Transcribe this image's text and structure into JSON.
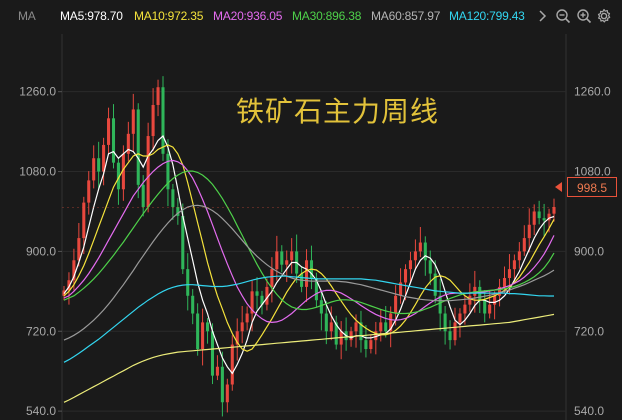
{
  "header": {
    "ma_label": "MA",
    "ma_items": [
      {
        "label": "MA5:978.70",
        "color": "#ffffff"
      },
      {
        "label": "MA10:972.35",
        "color": "#f5e33c"
      },
      {
        "label": "MA20:936.05",
        "color": "#e46cf0"
      },
      {
        "label": "MA30:896.38",
        "color": "#4ed14a"
      },
      {
        "label": "MA60:857.97",
        "color": "#b4b4b4"
      },
      {
        "label": "MA120:799.43",
        "color": "#33d6f0"
      }
    ],
    "icons": [
      "chevron-right-icon",
      "zoom-out-icon",
      "zoom-in-icon",
      "gear-icon"
    ]
  },
  "watermark": "铁矿石主力周线",
  "last_price": "998.5",
  "chart_data": {
    "type": "candlestick",
    "ylim": [
      520,
      1390
    ],
    "y_ticks": [
      "1260.0",
      "1080.0",
      "900.0",
      "720.0",
      "540.0"
    ],
    "y_tick_values": [
      1260,
      1080,
      900,
      720,
      540
    ],
    "colors": {
      "up": "#e8483e",
      "down": "#2fb65a",
      "grid": "#2a2a2a",
      "last": "#e9523a"
    },
    "last_price_value": 998.5,
    "closes": [
      812,
      835,
      880,
      930,
      1010,
      1060,
      1110,
      1080,
      1140,
      1200,
      1100,
      1040,
      1120,
      1165,
      1220,
      1050,
      1000,
      1160,
      1230,
      1270,
      1120,
      1040,
      1000,
      980,
      860,
      800,
      760,
      680,
      740,
      720,
      620,
      640,
      560,
      600,
      690,
      720,
      740,
      760,
      810,
      800,
      780,
      820,
      860,
      900,
      870,
      880,
      900,
      850,
      820,
      880,
      840,
      790,
      760,
      720,
      740,
      690,
      720,
      700,
      720,
      740,
      700,
      680,
      700,
      720,
      740,
      720,
      760,
      800,
      830,
      860,
      880,
      900,
      920,
      880,
      850,
      800,
      760,
      720,
      700,
      740,
      760,
      780,
      800,
      820,
      790,
      760,
      780,
      800,
      820,
      840,
      860,
      880,
      900,
      930,
      960,
      990,
      975,
      970,
      985,
      1000
    ],
    "series": [
      {
        "name": "MA5",
        "values": [
          805,
          820,
          843,
          875,
          910,
          955,
          1000,
          1040,
          1075,
          1120,
          1125,
          1110,
          1120,
          1130,
          1125,
          1110,
          1090,
          1115,
          1130,
          1150,
          1160,
          1135,
          1095,
          1040,
          980,
          930,
          880,
          830,
          790,
          760,
          720,
          690,
          660,
          640,
          625,
          645,
          670,
          700,
          740,
          765,
          780,
          795,
          810,
          830,
          845,
          860,
          875,
          875,
          865,
          860,
          850,
          835,
          810,
          780,
          755,
          735,
          720,
          710,
          705,
          710,
          710,
          705,
          705,
          708,
          712,
          715,
          725,
          745,
          770,
          800,
          830,
          860,
          880,
          890,
          885,
          870,
          845,
          810,
          775,
          745,
          735,
          745,
          760,
          778,
          790,
          790,
          785,
          785,
          790,
          800,
          815,
          835,
          855,
          880,
          905,
          930,
          950,
          965,
          975,
          978.7
        ]
      },
      {
        "name": "MA10",
        "values": [
          800,
          810,
          825,
          845,
          868,
          895,
          925,
          955,
          985,
          1015,
          1045,
          1065,
          1085,
          1100,
          1115,
          1120,
          1115,
          1115,
          1120,
          1130,
          1135,
          1140,
          1135,
          1120,
          1095,
          1055,
          1010,
          965,
          920,
          875,
          835,
          800,
          770,
          740,
          715,
          695,
          680,
          675,
          680,
          695,
          712,
          730,
          748,
          768,
          788,
          808,
          825,
          840,
          850,
          857,
          860,
          858,
          850,
          838,
          822,
          805,
          788,
          772,
          757,
          745,
          735,
          727,
          720,
          715,
          712,
          712,
          715,
          722,
          732,
          745,
          762,
          780,
          800,
          818,
          832,
          842,
          845,
          842,
          835,
          823,
          810,
          800,
          793,
          790,
          790,
          792,
          796,
          800,
          806,
          812,
          820,
          830,
          842,
          858,
          875,
          895,
          915,
          933,
          952,
          972.35
        ]
      },
      {
        "name": "MA20",
        "values": [
          795,
          800,
          810,
          822,
          835,
          850,
          867,
          885,
          905,
          925,
          945,
          965,
          985,
          1005,
          1025,
          1040,
          1055,
          1068,
          1080,
          1090,
          1098,
          1103,
          1105,
          1102,
          1095,
          1082,
          1065,
          1043,
          1017,
          990,
          960,
          930,
          900,
          872,
          845,
          820,
          800,
          782,
          768,
          757,
          748,
          742,
          740,
          741,
          745,
          752,
          760,
          770,
          780,
          790,
          798,
          805,
          810,
          812,
          812,
          810,
          806,
          800,
          793,
          786,
          778,
          771,
          764,
          758,
          753,
          749,
          746,
          745,
          746,
          749,
          754,
          760,
          768,
          776,
          784,
          791,
          797,
          802,
          805,
          806,
          806,
          806,
          806,
          807,
          808,
          809,
          811,
          813,
          816,
          819,
          823,
          828,
          834,
          842,
          852,
          864,
          878,
          894,
          914,
          936.05
        ]
      },
      {
        "name": "MA30",
        "values": [
          790,
          795,
          800,
          808,
          817,
          827,
          838,
          850,
          863,
          877,
          891,
          906,
          921,
          937,
          953,
          969,
          985,
          1000,
          1015,
          1029,
          1042,
          1054,
          1064,
          1072,
          1078,
          1081,
          1081,
          1078,
          1072,
          1063,
          1051,
          1036,
          1019,
          1000,
          980,
          958,
          936,
          914,
          892,
          871,
          851,
          833,
          817,
          803,
          791,
          782,
          775,
          771,
          769,
          769,
          771,
          774,
          778,
          782,
          786,
          789,
          791,
          791,
          790,
          788,
          785,
          781,
          777,
          773,
          769,
          766,
          763,
          761,
          760,
          760,
          761,
          763,
          766,
          770,
          774,
          779,
          784,
          789,
          794,
          798,
          802,
          805,
          807,
          809,
          810,
          811,
          812,
          813,
          814,
          816,
          818,
          821,
          825,
          830,
          836,
          843,
          852,
          863,
          878,
          896.38
        ]
      },
      {
        "name": "MA60",
        "values": [
          700,
          705,
          711,
          718,
          726,
          735,
          745,
          756,
          768,
          781,
          795,
          810,
          825,
          841,
          857,
          874,
          890,
          906,
          922,
          937,
          951,
          964,
          976,
          986,
          994,
          1000,
          1003,
          1004,
          1002,
          998,
          992,
          984,
          974,
          963,
          951,
          938,
          925,
          912,
          900,
          889,
          879,
          870,
          862,
          855,
          849,
          844,
          840,
          837,
          835,
          834,
          833,
          833,
          833,
          833,
          833,
          833,
          832,
          831,
          829,
          827,
          825,
          822,
          819,
          816,
          813,
          810,
          807,
          804,
          801,
          798,
          796,
          794,
          792,
          791,
          790,
          789,
          789,
          789,
          789,
          790,
          791,
          792,
          793,
          795,
          797,
          799,
          801,
          804,
          807,
          810,
          813,
          817,
          821,
          825,
          830,
          835,
          840,
          845,
          851,
          857.97
        ]
      },
      {
        "name": "MA120",
        "values": [
          650,
          656,
          663,
          670,
          678,
          686,
          694,
          702,
          711,
          720,
          729,
          738,
          747,
          756,
          765,
          774,
          782,
          790,
          797,
          804,
          810,
          815,
          819,
          822,
          824,
          825,
          825,
          824,
          823,
          822,
          821,
          821,
          821,
          822,
          824,
          826,
          829,
          832,
          835,
          838,
          840,
          842,
          843,
          844,
          844,
          844,
          843,
          842,
          841,
          840,
          839,
          838,
          838,
          838,
          838,
          838,
          838,
          838,
          838,
          838,
          838,
          837,
          836,
          835,
          833,
          831,
          829,
          827,
          825,
          823,
          821,
          819,
          817,
          815,
          813,
          811,
          810,
          809,
          808,
          807,
          806,
          806,
          806,
          806,
          806,
          806,
          806,
          806,
          806,
          806,
          805,
          805,
          804,
          803,
          802,
          801,
          800,
          800,
          799.5,
          799.43
        ]
      },
      {
        "name": "MA250",
        "values": [
          560,
          565,
          571,
          577,
          583,
          589,
          595,
          601,
          607,
          613,
          619,
          625,
          631,
          637,
          643,
          648,
          653,
          657,
          661,
          664,
          667,
          669,
          671,
          673,
          674,
          675,
          676,
          677,
          678,
          679,
          680,
          681,
          682,
          683,
          684,
          685,
          686,
          687,
          688,
          689,
          690,
          691,
          692,
          693,
          694,
          695,
          696,
          697,
          698,
          699,
          700,
          701,
          702,
          703,
          704,
          705,
          706,
          707,
          708,
          709,
          710,
          711,
          712,
          713,
          714,
          715,
          716,
          717,
          718,
          719,
          720,
          721,
          722,
          723,
          724,
          725,
          726,
          727,
          728,
          729,
          730,
          731,
          732,
          733,
          734,
          735,
          736,
          737,
          738,
          739,
          740,
          742,
          744,
          746,
          748,
          750,
          752,
          754,
          756,
          758
        ]
      }
    ],
    "series_colors": [
      "#ffffff",
      "#f5e33c",
      "#e46cf0",
      "#4ed14a",
      "#9a9a9a",
      "#33d6f0",
      "#ecec7a"
    ]
  }
}
